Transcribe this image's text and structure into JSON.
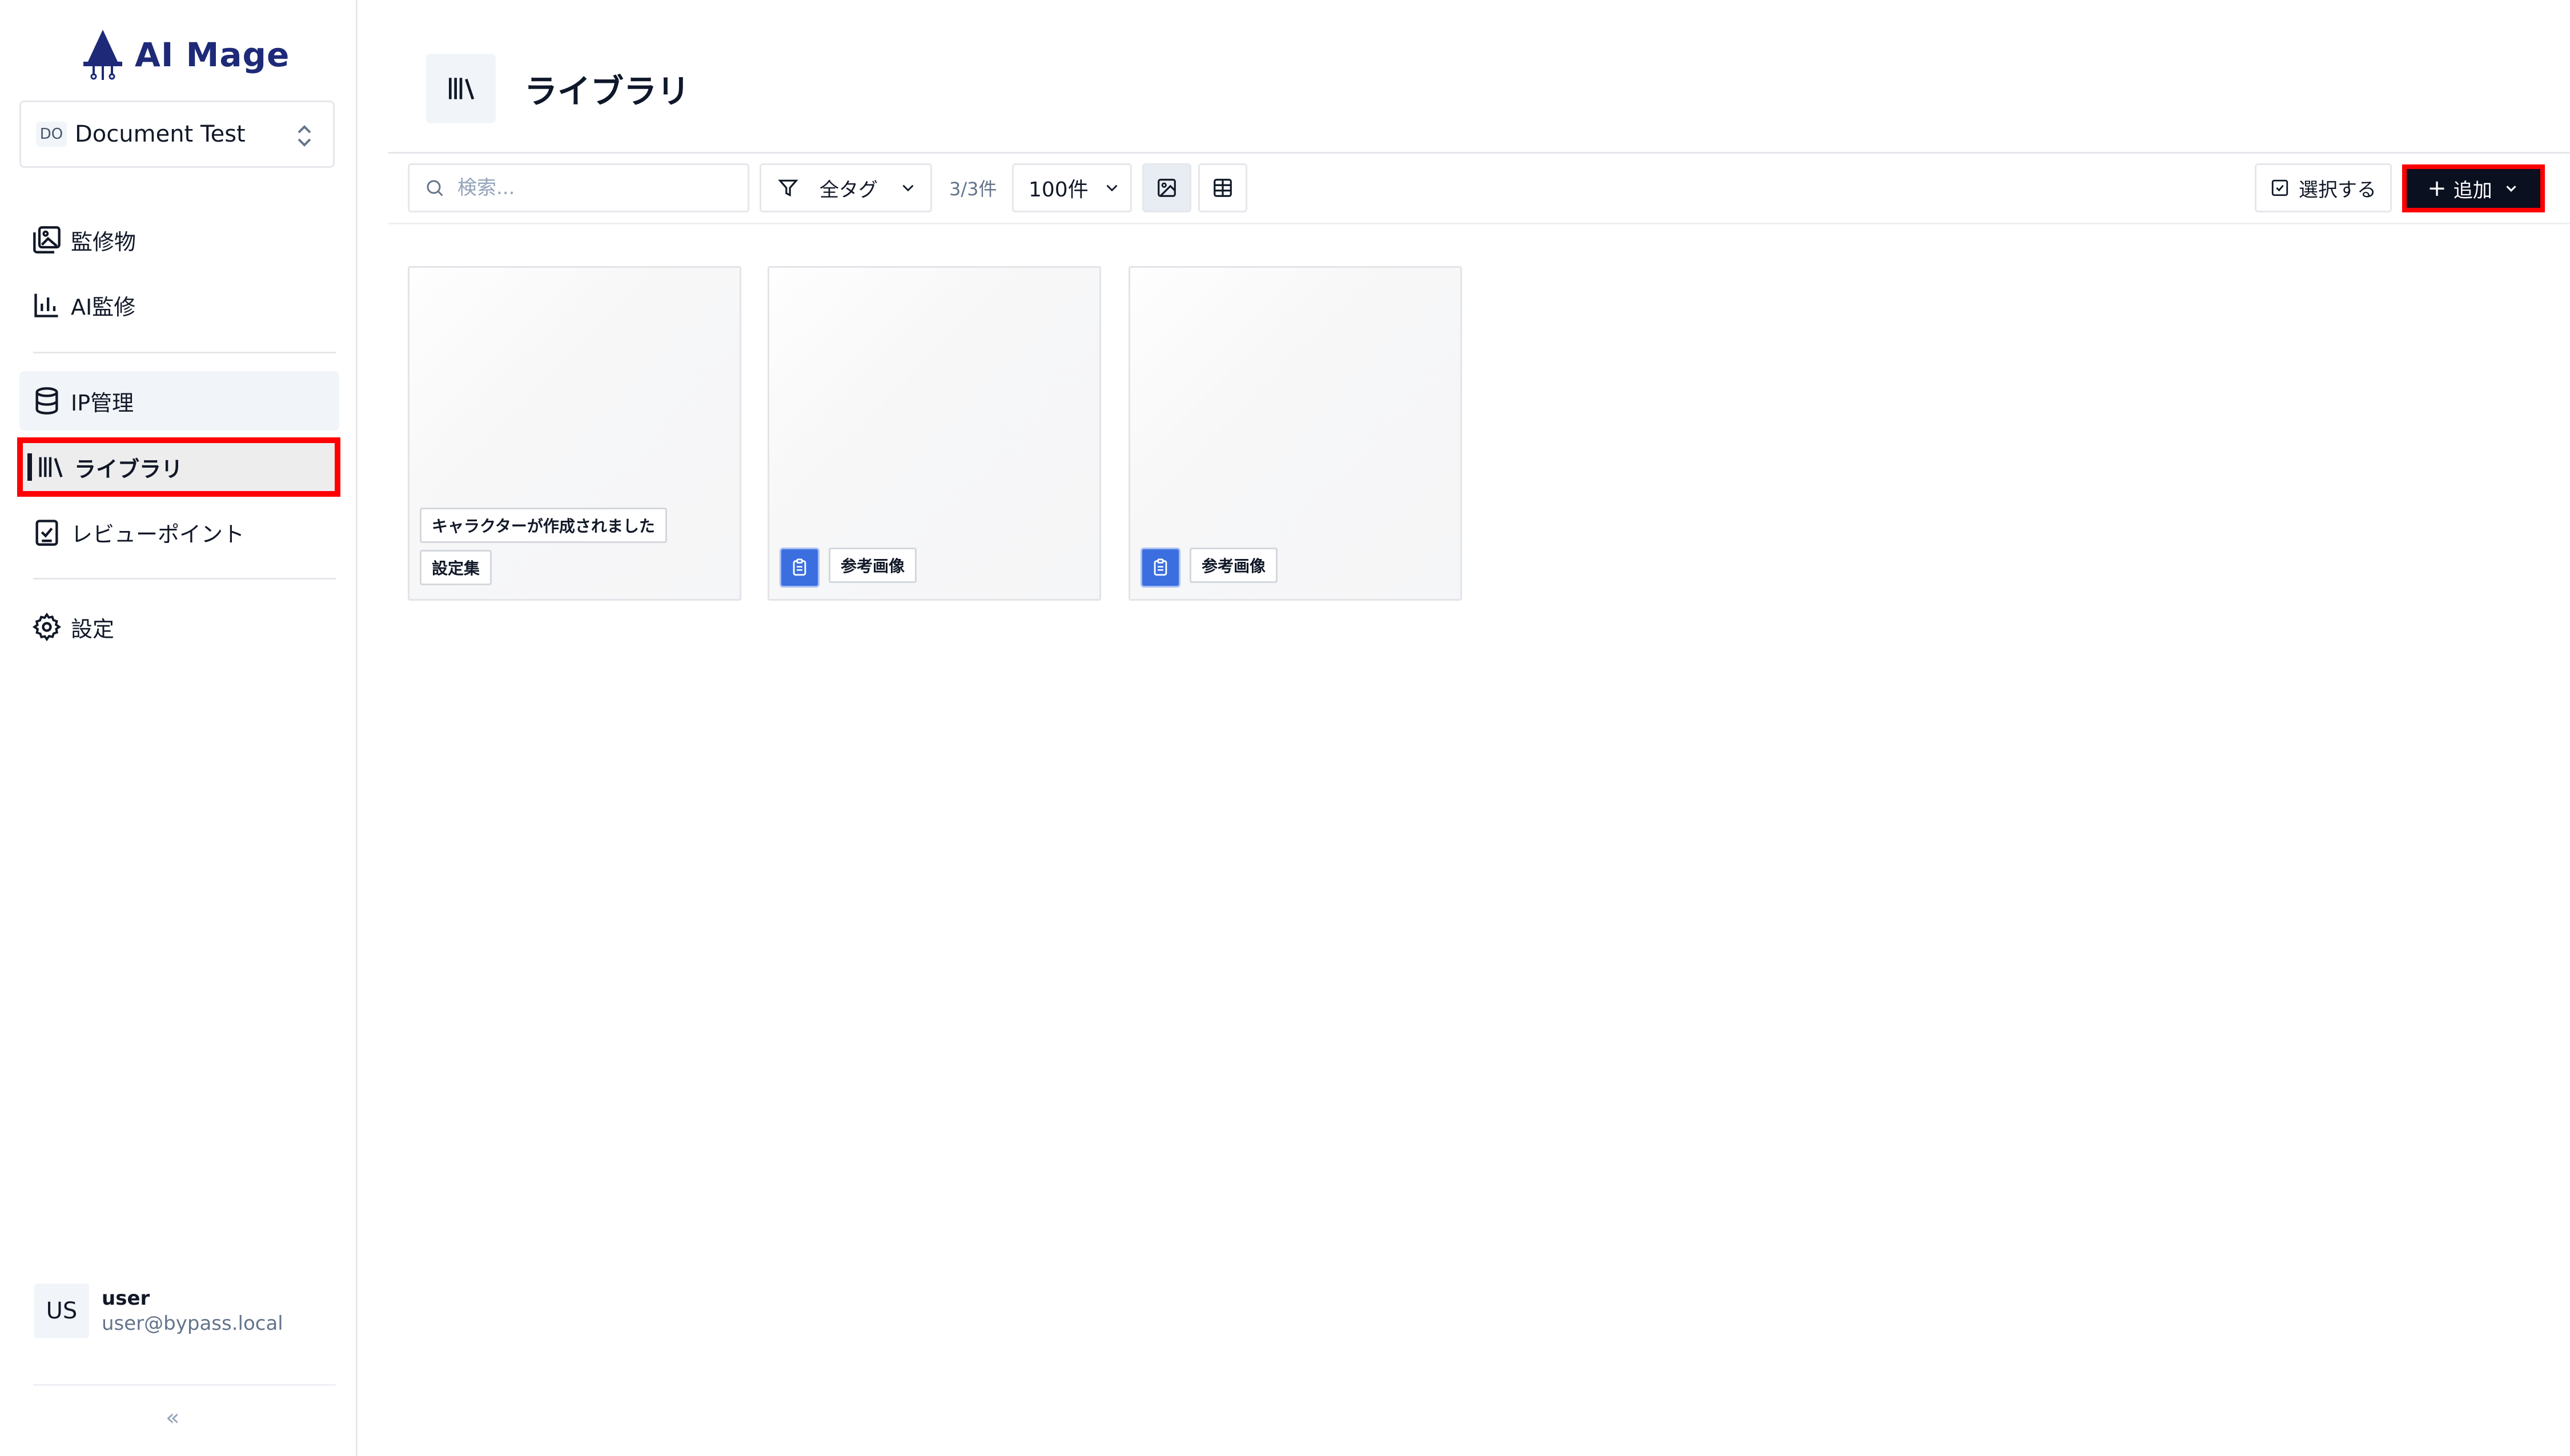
{
  "brand": {
    "name": "AI Mage",
    "color": "#1e2a78"
  },
  "workspace": {
    "badge": "DO",
    "name": "Document Test"
  },
  "nav": {
    "items": [
      {
        "label": "監修物",
        "icon": "image-gallery-icon"
      },
      {
        "label": "AI監修",
        "icon": "bar-chart-icon"
      },
      {
        "label": "IP管理",
        "icon": "database-icon"
      },
      {
        "label": "ライブラリ",
        "icon": "library-icon",
        "active": true
      },
      {
        "label": "レビューポイント",
        "icon": "clipboard-check-icon"
      },
      {
        "label": "設定",
        "icon": "gear-icon"
      }
    ]
  },
  "user": {
    "initials": "US",
    "name": "user",
    "email": "user@bypass.local"
  },
  "collapse_glyph": "«",
  "page": {
    "title": "ライブラリ",
    "icon": "library-icon"
  },
  "toolbar": {
    "search_placeholder": "検索...",
    "tag_filter": "全タグ",
    "count": "3/3件",
    "per_page": "100件",
    "select_label": "選択する",
    "add_label": "追加"
  },
  "cards": [
    {
      "tags": [
        "キャラクターが作成されました",
        "設定集"
      ],
      "has_icon": false
    },
    {
      "tags": [
        "参考画像"
      ],
      "has_icon": true,
      "icon": "clipboard-icon"
    },
    {
      "tags": [
        "参考画像"
      ],
      "has_icon": true,
      "icon": "clipboard-icon"
    }
  ],
  "colors": {
    "accent_primary": "#0b1020",
    "highlight": "#ff0000",
    "tag_icon_bg": "#3b6fe0"
  }
}
